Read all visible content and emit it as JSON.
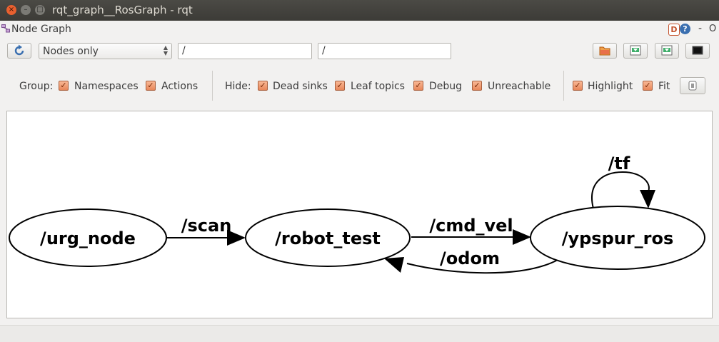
{
  "window": {
    "title": "rqt_graph__RosGraph - rqt",
    "close_glyph": "×",
    "minimize_glyph": "–",
    "maximize_glyph": "□"
  },
  "plugin": {
    "title": "Node Graph",
    "header_d": "D",
    "header_help": "?",
    "header_minus": "-",
    "header_o": "O"
  },
  "toolbar": {
    "filter_mode": "Nodes only",
    "node_filter": "/",
    "topic_filter": "/"
  },
  "options": {
    "group_label": "Group:",
    "group_items": [
      {
        "label": "Namespaces",
        "checked": true
      },
      {
        "label": "Actions",
        "checked": true
      }
    ],
    "hide_label": "Hide:",
    "hide_items": [
      {
        "label": "Dead sinks",
        "checked": true
      },
      {
        "label": "Leaf topics",
        "checked": true
      },
      {
        "label": "Debug",
        "checked": true
      },
      {
        "label": "Unreachable",
        "checked": true
      }
    ],
    "view_items": [
      {
        "label": "Highlight",
        "checked": true
      },
      {
        "label": "Fit",
        "checked": true
      }
    ],
    "check_glyph": "✓"
  },
  "graph": {
    "nodes": {
      "urg_node": "/urg_node",
      "robot_test": "/robot_test",
      "ypspur_ros": "/ypspur_ros"
    },
    "edges": {
      "scan": "/scan",
      "cmd_vel": "/cmd_vel",
      "odom": "/odom",
      "tf": "/tf"
    }
  },
  "colors": {
    "checkbox_fill": "#e8875a",
    "refresh_blue": "#3a6fb0",
    "titlebar": "#3c3b37"
  }
}
